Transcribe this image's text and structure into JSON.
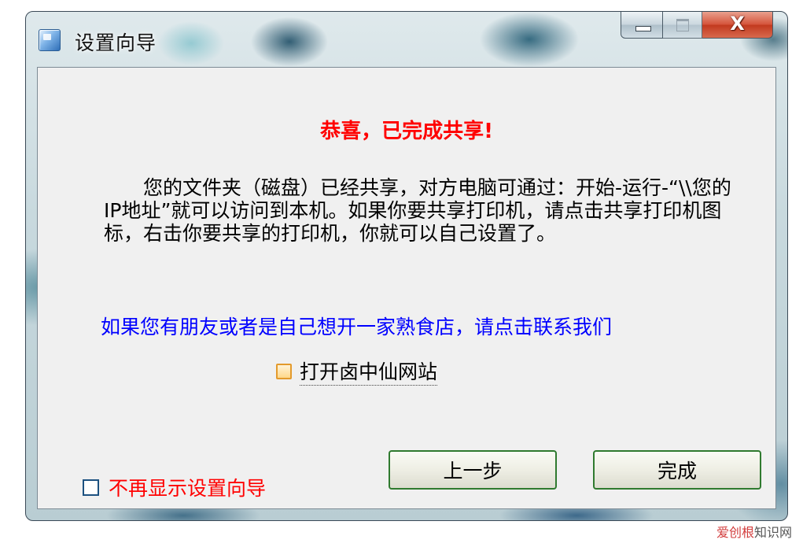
{
  "window": {
    "title": "设置向导",
    "close_glyph": "X"
  },
  "content": {
    "heading": "恭喜，已完成共享!",
    "body": "您的文件夹（磁盘）已经共享，对方电脑可通过：开始-运行-“\\\\您的IP地址”就可以访问到本机。如果你要共享打印机，请点击共享打印机图标，右击你要共享的打印机，你就可以自己设置了。",
    "contact_link": "如果您有朋友或者是自己想开一家熟食店，请点击联系我们",
    "open_site_label": "打开卤中仙网站",
    "no_show_label": "不再显示设置向导"
  },
  "buttons": {
    "prev": "上一步",
    "finish": "完成"
  },
  "watermark": {
    "accent": "爱创根",
    "rest": "知识网"
  },
  "icons": [
    "app-icon",
    "minimize-icon",
    "maximize-icon",
    "close-icon",
    "checkbox-icon"
  ],
  "colors": {
    "heading": "#ff0000",
    "link": "#0000ff",
    "no_show_label": "#ff0000",
    "button_border": "#2f7a2f",
    "close_button": "#c23a1f"
  }
}
